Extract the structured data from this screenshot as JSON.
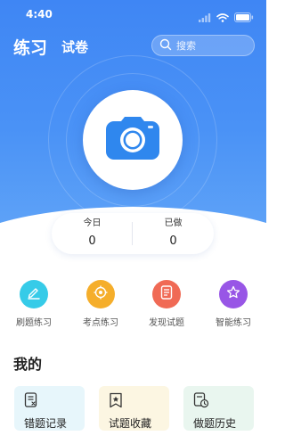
{
  "status_bar": {
    "time": "4:40"
  },
  "header": {
    "tab_active": "练习",
    "tab_inactive": "试卷",
    "search_placeholder": "搜索"
  },
  "camera": {
    "icon": "camera-icon",
    "accent": "#2f87ee"
  },
  "stats": {
    "today_label": "今日",
    "today_value": "0",
    "done_label": "已做",
    "done_value": "0"
  },
  "features": [
    {
      "label": "刷题练习",
      "icon": "pencil-icon",
      "color": "#36cbe8"
    },
    {
      "label": "考点练习",
      "icon": "target-icon",
      "color": "#f5ae2b"
    },
    {
      "label": "发现试题",
      "icon": "document-icon",
      "color": "#f06a55"
    },
    {
      "label": "智能练习",
      "icon": "star-icon",
      "color": "#9856e6"
    }
  ],
  "mine": {
    "title": "我的",
    "items": [
      {
        "label": "错题记录",
        "icon": "error-list-icon",
        "bg": "#e7f6fb"
      },
      {
        "label": "试题收藏",
        "icon": "bookmark-star-icon",
        "bg": "#fcf6e2"
      },
      {
        "label": "做题历史",
        "icon": "history-icon",
        "bg": "#e9f6ef"
      }
    ]
  }
}
